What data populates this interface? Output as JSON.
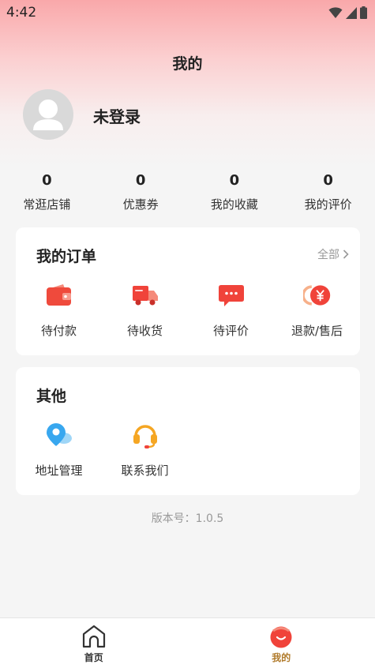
{
  "status_bar": {
    "time": "4:42"
  },
  "header": {
    "title": "我的"
  },
  "profile": {
    "login_text": "未登录"
  },
  "stats": [
    {
      "value": "0",
      "label": "常逛店铺"
    },
    {
      "value": "0",
      "label": "优惠券"
    },
    {
      "value": "0",
      "label": "我的收藏"
    },
    {
      "value": "0",
      "label": "我的评价"
    }
  ],
  "orders": {
    "title": "我的订单",
    "all_label": "全部",
    "items": [
      {
        "label": "待付款",
        "icon": "wallet-icon"
      },
      {
        "label": "待收货",
        "icon": "truck-icon"
      },
      {
        "label": "待评价",
        "icon": "comment-icon"
      },
      {
        "label": "退款/售后",
        "icon": "yuan-refund-icon"
      }
    ]
  },
  "other": {
    "title": "其他",
    "items": [
      {
        "label": "地址管理",
        "icon": "location-pin-icon"
      },
      {
        "label": "联系我们",
        "icon": "headset-icon"
      }
    ]
  },
  "version": "版本号：1.0.5",
  "tabbar": {
    "items": [
      {
        "label": "首页",
        "icon": "home-icon",
        "active": false
      },
      {
        "label": "我的",
        "icon": "profile-face-icon",
        "active": true
      }
    ],
    "active_color": "#b07a2a",
    "inactive_color": "#333333"
  },
  "colors": {
    "accent_red": "#f0433a",
    "header_gradient_top": "#f9a8aa",
    "version_text": "#999999"
  }
}
